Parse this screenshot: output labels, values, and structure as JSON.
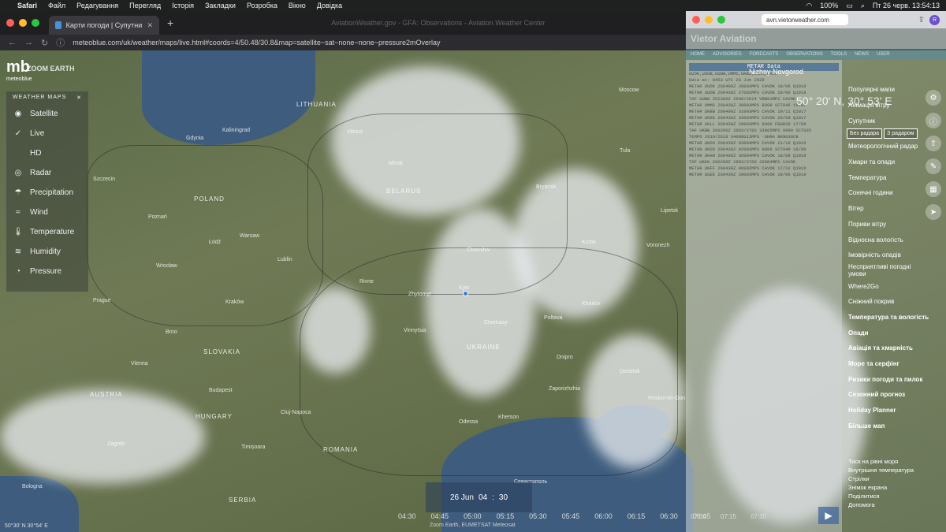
{
  "menubar": {
    "app": "Safari",
    "items": [
      "Файл",
      "Редагування",
      "Перегляд",
      "Історія",
      "Закладки",
      "Розробка",
      "Вікно",
      "Довідка"
    ],
    "battery": "100%",
    "datetime": "Пт 26 черв.  13:54:13"
  },
  "browser": {
    "tab_title": "Карти погоди | Супутникові ме",
    "address": "meteoblue.com/uk/weather/maps/live.html#coords=4/50.48/30.8&map=satellite~sat~none~none~pressure2mOverlay",
    "ghost_title": "AviationWeather.gov - GFA: Observations - Aviation Weather Center"
  },
  "logo": {
    "name": "mb",
    "sub": "meteoblue",
    "zoom": "ZOOM EARTH"
  },
  "layers": {
    "heading": "WEATHER MAPS",
    "items": [
      {
        "label": "Satellite",
        "icon": "satellite-icon"
      },
      {
        "label": "Live",
        "icon": "check-icon"
      },
      {
        "label": "HD",
        "icon": "hd-icon"
      },
      {
        "label": "Radar",
        "icon": "radar-icon"
      },
      {
        "label": "Precipitation",
        "icon": "rain-icon"
      },
      {
        "label": "Wind",
        "icon": "wind-icon"
      },
      {
        "label": "Temperature",
        "icon": "thermometer-icon"
      },
      {
        "label": "Humidity",
        "icon": "humidity-icon"
      },
      {
        "label": "Pressure",
        "icon": "gauge-icon"
      }
    ]
  },
  "map": {
    "countries": [
      "LITHUANIA",
      "BELARUS",
      "POLAND",
      "UKRAINE",
      "SLOVAKIA",
      "AUSTRIA",
      "HUNGARY",
      "ROMANIA",
      "SERBIA"
    ],
    "cities": [
      "Moscow",
      "Vilnius",
      "Minsk",
      "Warsaw",
      "Poznań",
      "Łódź",
      "Lublin",
      "Kraków",
      "Wrocław",
      "Prague",
      "Brno",
      "Vienna",
      "Budapest",
      "Kyiv",
      "Rivne",
      "Zhytomyr",
      "Vinnytsia",
      "Cherkasy",
      "Poltava",
      "Kharkiv",
      "Dnipro",
      "Donetsk",
      "Zaporizhzhia",
      "Kherson",
      "Odessa",
      "Chernihiv",
      "Bryansk",
      "Kursk",
      "Voronezh",
      "Lipetsk",
      "Tula",
      "Kaliningrad",
      "Gdynia",
      "Szczecin",
      "Cluj-Napoca",
      "Zagreb",
      "Bologna",
      "Timișoara",
      "Rostov-on-Don",
      "Севастополь"
    ],
    "coords": "50°30' N 30°54' E"
  },
  "time": {
    "date": "26 Jun",
    "hour": "04",
    "minute": "30",
    "ticks": [
      "04:30",
      "04:45",
      "05:00",
      "05:15",
      "05:30",
      "05:45",
      "06:00",
      "06:15",
      "06:30",
      "06:45"
    ],
    "attribution": "Zoom Earth, EUMETSAT Meteosat"
  },
  "right_window": {
    "address": "avn.vietorweather.com",
    "brand": "Vietor Aviation",
    "nav": [
      "HOME",
      "ADVISORIES",
      "FORECASTS",
      "OBSERVATIONS",
      "TOOLS",
      "NEWS",
      "USER"
    ],
    "metar_title": "METAR Data",
    "metar_ids": "UUOK,UUOB,UUWW,UMMS,UKBB,UKKK,UKLL",
    "data_at": "Data at: 0453 UTC 26 Jun 2026",
    "location": "Nizhny Novgorod",
    "coordinate": "50° 20' N, 30° 53' E",
    "metar_lines": [
      "METAR UUOK 260400Z 28003MPS CAVOK 18/06 Q1018",
      "METAR UUOB 260430Z 27002MPS CAVOK 20/06 Q1018",
      "TAF UUWW 252300Z 2600/2624 VRB01MPS CAVOK",
      "METAR UMMS 260430Z 30003MPS 9999 SCT046 15/07",
      "METAR UKBB 260400Z 31003MPS CAVOK 19/11 Q1017",
      "METAR UKKK 260430Z 33004MPS CAVOK 20/09 Q1017",
      "METAR UKLL 260430Z 29003MPS 9999 FEW030 17/08",
      "TAF UKBB 260200Z 2603/2703 33005MPS 9999 SCT035",
      "TEMPO 2610/2618 34008G13MPS -SHRA BKN030CB",
      "METAR UKOO 260430Z 03004MPS CAVOK 21/10 Q1016",
      "METAR UKDD 260430Z 02003MPS 9999 SCT040 19/09",
      "METAR UKHH 260400Z 36004MPS CAVOK 18/08 Q1018",
      "TAF UKKK 260200Z 2603/2703 32004MPS CAVOK",
      "METAR UKFF 260430Z 06002MPS CAVOK 17/12 Q1016",
      "METAR UUEE 260430Z 28003MPS CAVOK 19/06 Q1019"
    ],
    "menu": [
      {
        "label": "Популярні мапи",
        "bold": false
      },
      {
        "label": "Анімація вітру",
        "bold": false
      },
      {
        "label": "Супутник",
        "bold": false
      },
      {
        "label": "Метеорологічний радар",
        "bold": false
      },
      {
        "label": "Хмари та опади",
        "bold": false
      },
      {
        "label": "Температура",
        "bold": false
      },
      {
        "label": "Сонячні години",
        "bold": false
      },
      {
        "label": "Вітер",
        "bold": false
      },
      {
        "label": "Пориви вітру",
        "bold": false
      },
      {
        "label": "Відносна вологість",
        "bold": false
      },
      {
        "label": "Імовірність опадів",
        "bold": false
      },
      {
        "label": "Несприятливі погодні умови",
        "bold": false
      },
      {
        "label": "Where2Go",
        "bold": false
      },
      {
        "label": "Сніжний покрив",
        "bold": false
      },
      {
        "label": "Температура та вологість",
        "bold": true
      },
      {
        "label": "Опади",
        "bold": true
      },
      {
        "label": "Авіація та хмарність",
        "bold": true
      },
      {
        "label": "Море та серфінг",
        "bold": true
      },
      {
        "label": "Ризики погоди та пилок",
        "bold": true
      },
      {
        "label": "Сезонний прогноз",
        "bold": true
      },
      {
        "label": "Holiday Planner",
        "bold": true
      },
      {
        "label": "Більше мап",
        "bold": true
      }
    ],
    "radar_no": "Без радара",
    "radar_yes": "З радаром",
    "bottom_menu": [
      "Тиск на рівні моря",
      "Внутрішня температура",
      "Стрілки",
      "Знімок екрана",
      "Поділитися",
      "Допомога"
    ],
    "play_ticks": [
      "07:00",
      "07:15",
      "07:30"
    ],
    "play_label": "▶"
  }
}
